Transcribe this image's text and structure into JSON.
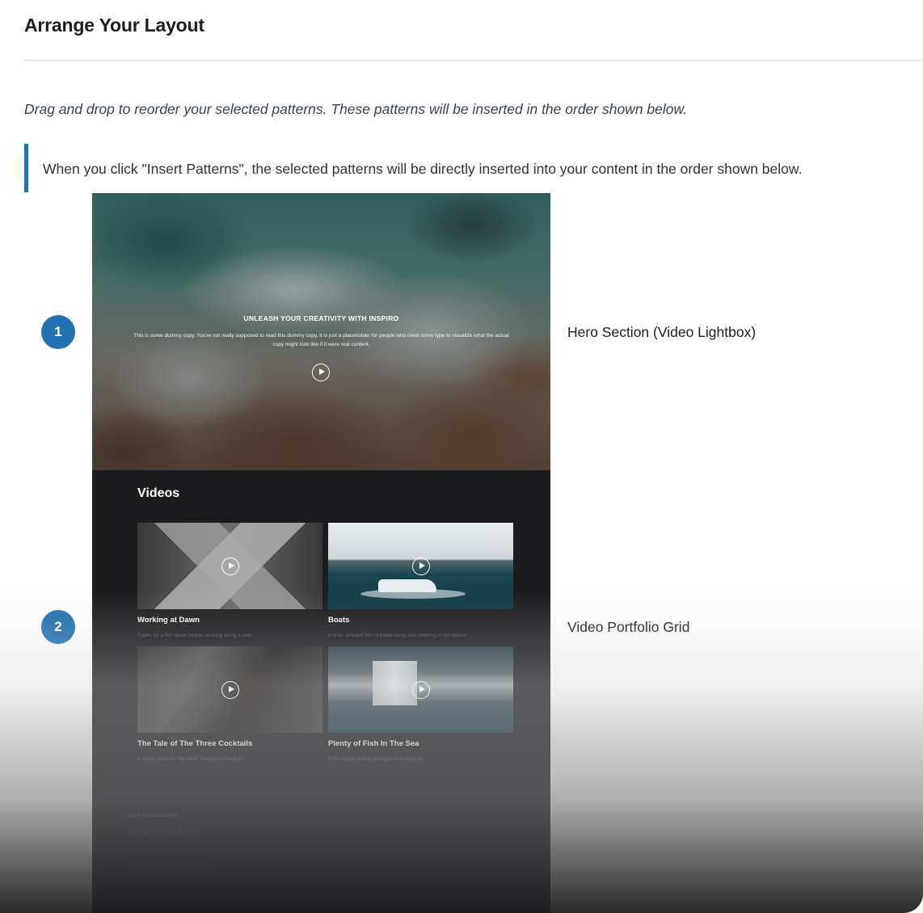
{
  "page": {
    "title": "Arrange Your Layout",
    "description": "Drag and drop to reorder your selected patterns. These patterns will be inserted in the order shown below.",
    "notice": "When you click \"Insert Patterns\", the selected patterns will be directly inserted into your content in the order shown below."
  },
  "patterns": [
    {
      "number": "1",
      "label": "Hero Section (Video Lightbox)"
    },
    {
      "number": "2",
      "label": "Video Portfolio Grid"
    }
  ],
  "preview": {
    "hero": {
      "heading": "UNLEASH YOUR CREATIVITY WITH INSPIRO",
      "body": "This is some dummy copy. You're not really supposed to read this dummy copy, it is just a placeholder for people who need some type to visualize what the actual copy might look like if it were real content."
    },
    "videos": {
      "title": "Videos",
      "items": [
        {
          "title": "Working at Dawn",
          "desc": "Trailer for a film about people working along a river."
        },
        {
          "title": "Boats",
          "desc": "A brief, ambient film of boats rising and lowering in the waves."
        },
        {
          "title": "The Tale of The Three Cocktails",
          "desc": "A music video for the band \"Generous Penguin\""
        },
        {
          "title": "Plenty of Fish In The Sea",
          "desc": "A film about finding what you're looking for."
        }
      ]
    },
    "philosophy": {
      "eyebrow": "OUR PHILOSOPHY",
      "title": "What we belive in",
      "body": "This is some dummy copy. You're not really supposed to read this dummy copy, it is just a placeholder for people who need some type to visualize."
    }
  },
  "colors": {
    "accent": "#2271b1",
    "preview_bg": "#1c1c1e"
  },
  "icons": {
    "play": "play-circle-icon"
  }
}
